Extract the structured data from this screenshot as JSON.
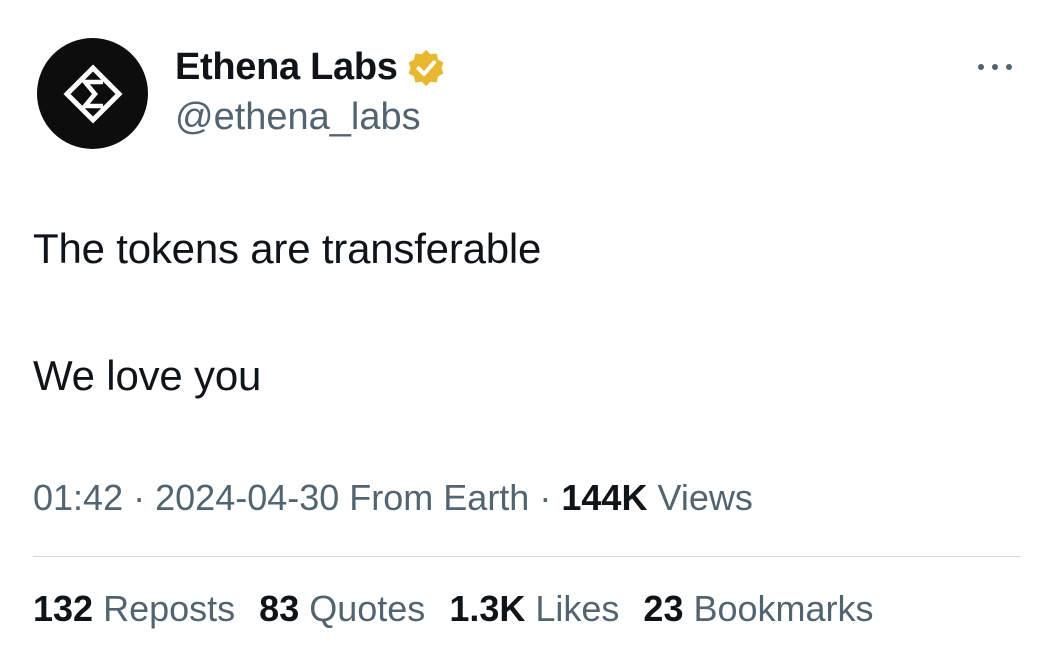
{
  "author": {
    "name": "Ethena Labs",
    "handle": "@ethena_labs",
    "verified_color": "#e8b830",
    "avatar_bg": "#0d0d0d"
  },
  "tweet": {
    "lines": [
      "The tokens are transferable",
      "We love you"
    ]
  },
  "meta": {
    "time": "01:42",
    "separator": "·",
    "date": "2024-04-30",
    "source": "From Earth",
    "views_count": "144K",
    "views_label": "Views"
  },
  "stats": {
    "reposts_count": "132",
    "reposts_label": "Reposts",
    "quotes_count": "83",
    "quotes_label": "Quotes",
    "likes_count": "1.3K",
    "likes_label": "Likes",
    "bookmarks_count": "23",
    "bookmarks_label": "Bookmarks"
  },
  "icons": {
    "avatar_logo": "ethena-logo-icon",
    "verified": "verified-badge-icon",
    "more": "more-options-icon"
  }
}
